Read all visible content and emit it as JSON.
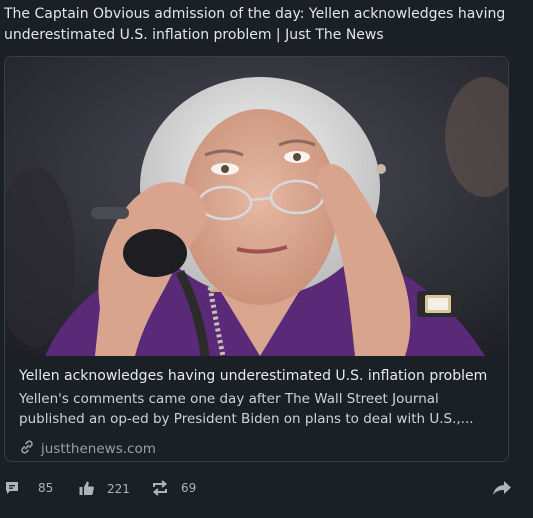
{
  "post": {
    "title": "The Captain Obvious admission of the day: Yellen acknowledges having underestimated U.S. inflation problem | Just The News"
  },
  "link_card": {
    "title": "Yellen acknowledges having underestimated U.S. inflation problem",
    "description": "Yellen's comments came one day after The Wall Street Journal published an op-ed by President Biden on plans to deal with U.S.,...",
    "domain": "justthenews.com",
    "domain_icon": "link-icon"
  },
  "actions": {
    "comments": {
      "icon": "comment-icon",
      "count": "85"
    },
    "likes": {
      "icon": "thumbs-up-icon",
      "count": "221"
    },
    "reposts": {
      "icon": "repost-icon",
      "count": "69"
    },
    "share": {
      "icon": "share-icon"
    }
  },
  "colors": {
    "background": "#1b1f26",
    "card_border": "#3a3f47",
    "purple_jacket": "#5a2a78"
  }
}
